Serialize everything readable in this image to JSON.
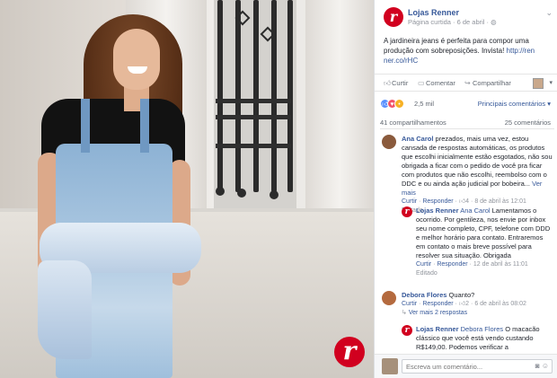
{
  "photo": {
    "brand_logo": "r"
  },
  "post": {
    "page_name": "Lojas Renner",
    "meta": "Página curtida · 6 de abril ·",
    "text": "A jardineira jeans é perfeita para compor uma produção com sobreposições. Invista!",
    "link": "http://ren ner.co/rHC",
    "logo_letter": "r"
  },
  "actions": {
    "like": "Curtir",
    "comment": "Comentar",
    "share": "Compartilhar"
  },
  "stats": {
    "reactions_count": "2,5 mil",
    "sort": "Principais comentários ▾",
    "shares": "41 compartilhamentos",
    "comments": "25 comentários"
  },
  "comments": [
    {
      "author": "Ana Carol",
      "text": "prezados, mais uma vez, estou cansada de respostas automáticas, os produtos que escolhi inicialmente estão esgotados, não sou obrigada a ficar com o pedido de você pra ficar com produtos que não escolhi, reembolso com o DDC e ou ainda ação judicial por bobeira...",
      "more": "Ver mais",
      "like": "Curtir",
      "reply": "Responder",
      "likes": "4",
      "time": "8 de abril às 12:01",
      "edited": "Editado"
    },
    {
      "author": "Lojas Renner",
      "mention": "Ana Carol",
      "text": "Lamentamos o ocorrido. Por gentileza, nos envie por inbox seu nome completo, CPF, telefone com DDD e melhor horário para contato. Entraremos em contato o mais breve possível para resolver sua situação. Obrigada",
      "like": "Curtir",
      "reply": "Responder",
      "time": "12 de abril às 11:01",
      "edited": "Editado"
    },
    {
      "author": "Debora Flores",
      "text": "Quanto?",
      "like": "Curtir",
      "reply": "Responder",
      "likes": "2",
      "time": "6 de abril às 08:02",
      "replies_link": "Ver mais 2 respostas"
    },
    {
      "author": "Lojas Renner",
      "mention": "Debora Flores",
      "text": "O macacão clássico que você está vendo custando R$149,00. Podemos verificar a"
    }
  ],
  "composer": {
    "placeholder": "Escreva um comentário..."
  },
  "colors": {
    "brand_red": "#d1001f",
    "fb_link": "#365899",
    "like_blue": "#5890ff",
    "love_red": "#f25268"
  }
}
